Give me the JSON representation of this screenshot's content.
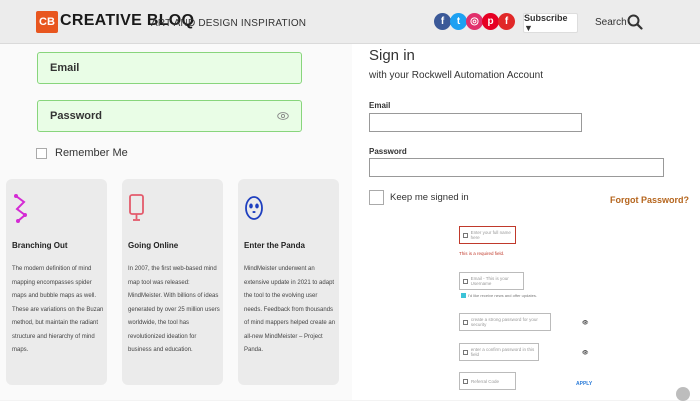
{
  "header": {
    "logo_mark": "CB",
    "logo_text": "CREATIVE BLOQ",
    "tagline": "ART AND DESIGN INSPIRATION",
    "social": [
      {
        "name": "facebook-icon",
        "glyph": "f",
        "color": "#3b5998"
      },
      {
        "name": "twitter-icon",
        "glyph": "t",
        "color": "#1da1f2"
      },
      {
        "name": "instagram-icon",
        "glyph": "◎",
        "color": "#e1306c"
      },
      {
        "name": "pinterest-icon",
        "glyph": "p",
        "color": "#e60023"
      },
      {
        "name": "flipboard-icon",
        "glyph": "f",
        "color": "#e12828"
      }
    ],
    "subscribe_label": "Subscribe ▼",
    "search_label": "Search"
  },
  "left": {
    "email_label": "Email",
    "password_label": "Password",
    "remember_label": "Remember Me",
    "cards": [
      {
        "icon": "branching-icon",
        "title": "Branching Out",
        "body": "The modern definition of mind mapping encompasses spider maps and bubble maps as well. These are variations on the Buzan method, but maintain the radiant structure and hierarchy of mind maps."
      },
      {
        "icon": "tablet-icon",
        "title": "Going Online",
        "body": "In 2007, the first web-based mind map tool was released: MindMeister. With billions of ideas generated by over 25 million users worldwide, the tool has revolutionized ideation for business and education."
      },
      {
        "icon": "panda-icon",
        "title": "Enter the Panda",
        "body": "MindMeister underwent an extensive update in 2021 to adapt the tool to the evolving user needs. Feedback from thousands of mind mappers helped create an all-new MindMeister – Project Panda."
      }
    ]
  },
  "right": {
    "title": "Sign in",
    "subtitle": "with your Rockwell Automation Account",
    "email_label": "Email",
    "password_label": "Password",
    "keep_label": "Keep me signed in",
    "forgot_label": "Forgot Password?",
    "mini_form": {
      "fullname_placeholder": "Enter your full name here",
      "required_msg": "This is a required field.",
      "email_placeholder": "Email - This is your Username",
      "offers_label": "I'd like receive news and offer updates.",
      "password_placeholder": "create a strong password for your security",
      "confirm_placeholder": "enter a confirm password in this field",
      "eye_glyph": "👁",
      "referral_placeholder": "Referral Code",
      "apply_label": "APPLY"
    }
  }
}
